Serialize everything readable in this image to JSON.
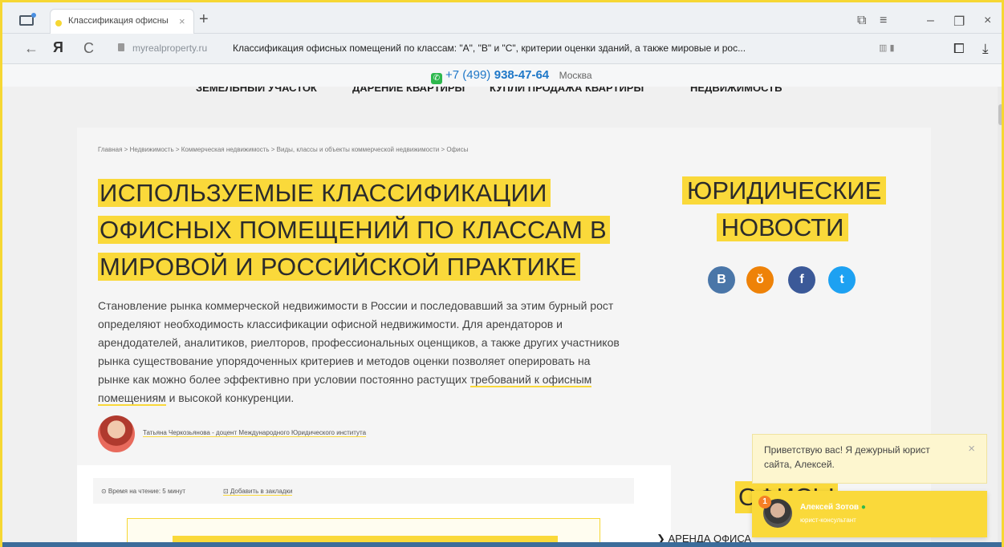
{
  "browser": {
    "tab_title": "Классификация офисны",
    "tab_close": "×",
    "new_tab": "+",
    "ya_logo": "Я",
    "url_domain": "myrealproperty.ru",
    "url_title": "Классификация офисных помещений по классам: \"A\", \"B\" и \"C\", критерии оценки зданий, а также мировые и рос...",
    "back": "←",
    "reload": "C",
    "minimize": "–",
    "maximize": "❐",
    "close": "×",
    "menu": "≡",
    "download": "⤓",
    "icons": {
      "tabs": "tabs-icon",
      "lock": "lock-icon",
      "reader": "reader-icon",
      "bookmark": "bookmark-icon",
      "protect": "protect-icon"
    }
  },
  "site": {
    "phone_code": "+7 (499)",
    "phone_number": "938-47-64",
    "city": "Москва",
    "menu": [
      "ЗЕМЕЛЬНЫЙ УЧАСТОК",
      "ДАРЕНИЕ КВАРТИРЫ",
      "КУПЛИ ПРОДАЖА КВАРТИРЫ",
      "НЕДВИЖИМОСТЬ"
    ]
  },
  "article": {
    "breadcrumbs": "Главная > Недвижимость > Коммерческая недвижимость > Виды, классы и объекты коммерческой недвижимости > Офисы",
    "title_lines": [
      "ИСПОЛЬЗУЕМЫЕ КЛАССИФИКАЦИИ",
      "ОФИСНЫХ ПОМЕЩЕНИЙ ПО КЛАССАМ В",
      "МИРОВОЙ И РОССИЙСКОЙ ПРАКТИКЕ"
    ],
    "lead_part1": "Становление рынка коммерческой недвижимости в России и последовавший за этим бурный рост определяют необходимость классификации офисной недвижимости. Для арендаторов и арендодателей, аналитиков, риелторов, профессиональных оценщиков, а также других участников рынка существование упорядоченных критериев и методов оценки позволяет оперировать на рынке как можно более эффективно при условии постоянно растущих ",
    "lead_link": "требований к офисным помещениям",
    "lead_part2": " и высокой конкуренции.",
    "author": "Татьяна Черкозьянова - доцент Международного Юридического института",
    "read_time": "⊙ Время на чтение: 5 минут",
    "bookmark": "⊡ Добавить в закладки"
  },
  "sidebar": {
    "title_lines": [
      "ЮРИДИЧЕСКИЕ",
      "НОВОСТИ"
    ],
    "social": [
      {
        "name": "vk",
        "glyph": "В",
        "color": "#4a76a8"
      },
      {
        "name": "ok",
        "glyph": "ŏ",
        "color": "#ee8208"
      },
      {
        "name": "facebook",
        "glyph": "f",
        "color": "#3b5998"
      },
      {
        "name": "twitter",
        "glyph": "t",
        "color": "#1da1f2"
      }
    ],
    "offices_label": "ОФИСЫ",
    "rent_link": "❯ АРЕНДА ОФИСА"
  },
  "chat": {
    "message": "Приветствую вас! Я дежурный юрист сайта, Алексей.",
    "close": "×",
    "badge": "1",
    "name": "Алексей Зотов",
    "online_dot": "●",
    "role": "юрист-консультант"
  }
}
